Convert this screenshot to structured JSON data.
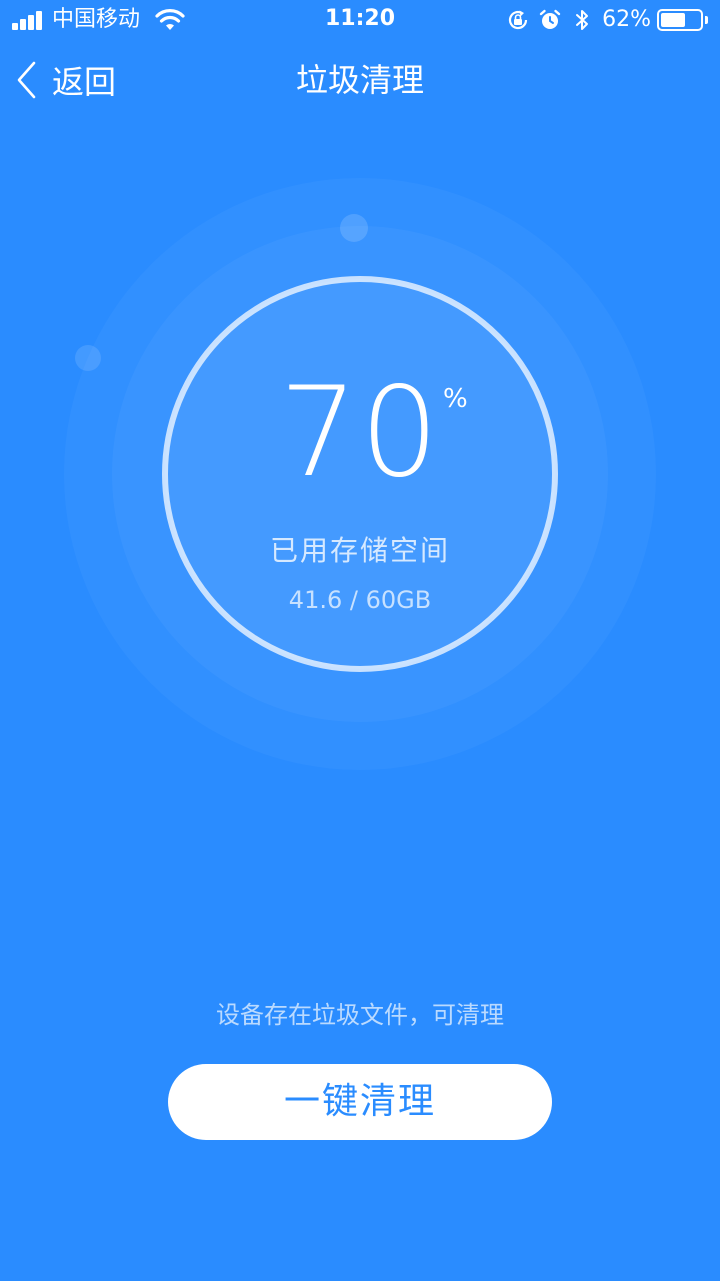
{
  "status_bar": {
    "carrier": "中国移动",
    "time": "11:20",
    "battery_percent": "62%",
    "battery_level": 0.62,
    "icons": [
      "signal-icon",
      "wifi-icon",
      "rotation-lock-icon",
      "alarm-icon",
      "bluetooth-icon",
      "battery-icon"
    ]
  },
  "nav": {
    "back_label": "返回",
    "title": "垃圾清理"
  },
  "gauge": {
    "value": "70",
    "unit": "%",
    "label": "已用存储空间",
    "detail": "41.6 / 60GB",
    "used_fraction": 0.7
  },
  "hint": "设备存在垃圾文件，可清理",
  "clean_button": "一键清理",
  "colors": {
    "background": "#2a8cff",
    "button_text": "#2a8cff"
  }
}
